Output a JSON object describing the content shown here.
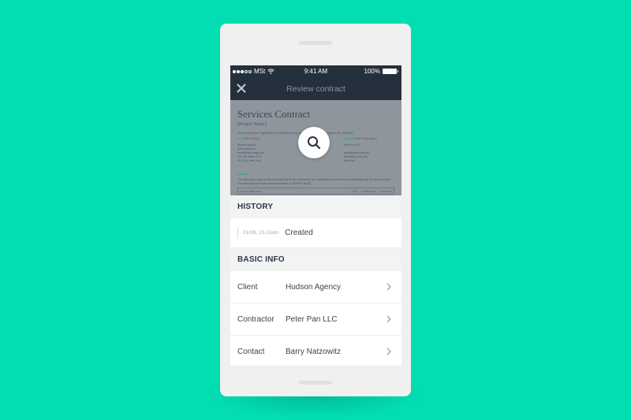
{
  "colors": {
    "background": "#02DDB2",
    "device": "#EFF0EF",
    "nav_bar": "#25303D",
    "accent": "#0EA586"
  },
  "status_bar": {
    "carrier": "MSt",
    "time": "9:41 AM",
    "battery": "100%",
    "signal_icon": "signal-dots-icon",
    "wifi_icon": "wifi-icon",
    "battery_icon": "battery-icon"
  },
  "nav": {
    "close_icon": "close-icon",
    "title": "Review contract"
  },
  "preview": {
    "doc_title": "Services Contract",
    "doc_subtitle": "[Project Name]",
    "intro": "This contract (the \"Agreement\") is entered into by and between the below parties (the \"Parties\").",
    "client_heading": "Client",
    "client_heading_suffix": "(the \"Client\")",
    "client_lines": [
      "Hudson Agency",
      "Barry Natzowitz",
      "barry@hudsonagc.com",
      "1221 AB Street, Fl 3",
      "NY 11111, New York"
    ],
    "contractor_heading": "Contractor",
    "contractor_heading_suffix": "(the \"Contractor\")",
    "contractor_lines": [
      "Peter Pan LLC",
      "",
      "peter@petermarter.co",
      "Broadway, Suite 430",
      "New York"
    ],
    "services_heading": "Services",
    "services_text": "The Client has a need for the following services (the \"Services\") and Contractor has an interest in performing such Services for Client. This offer will expire at the close of business on [EXPIRY DATE].",
    "table_service": "Service: [SERVICE]",
    "table_qty": "[QTY]",
    "table_rate": "[RATE]/[UNIT]",
    "table_amount": "[AMOUNT]",
    "zoom_icon": "magnifier-icon"
  },
  "history": {
    "heading": "HISTORY",
    "items": [
      {
        "time": "01/08, 10.10am",
        "event": "Created"
      }
    ]
  },
  "basic_info": {
    "heading": "BASIC INFO",
    "rows": [
      {
        "label": "Client",
        "value": "Hudson Agency"
      },
      {
        "label": "Contractor",
        "value": "Peter Pan LLC"
      },
      {
        "label": "Contact",
        "value": "Barry Natzowitz"
      }
    ]
  }
}
